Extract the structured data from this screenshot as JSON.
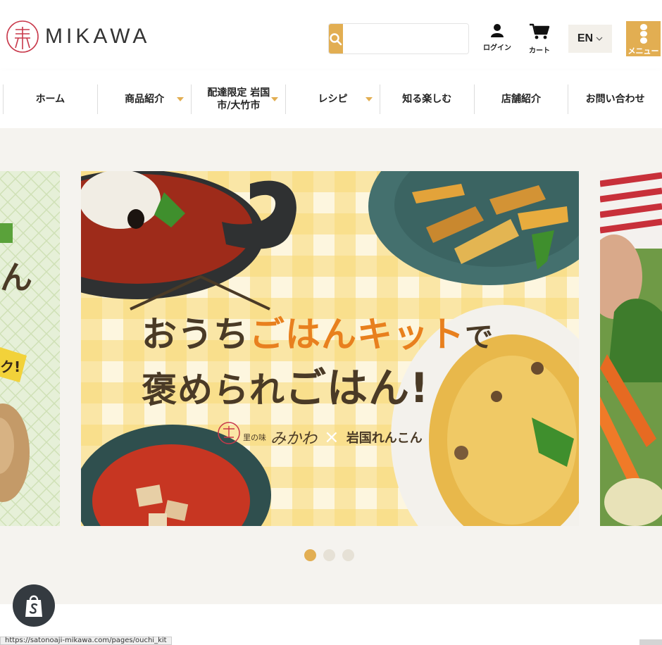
{
  "header": {
    "brand": "MIKAWA",
    "search_placeholder": "",
    "login_label": "ログイン",
    "cart_label": "カート",
    "language_code": "EN",
    "menu_label": "メニュー"
  },
  "nav": {
    "items": [
      {
        "label": "ホーム"
      },
      {
        "label": "商品紹介"
      },
      {
        "label_line1": "配達限定 岩国",
        "label_line2": "市/大竹市"
      },
      {
        "label": "レシピ"
      },
      {
        "label": "知る楽しむ"
      },
      {
        "label": "店舗紹介"
      },
      {
        "label": "お問い合わせ"
      }
    ]
  },
  "hero": {
    "main_slide": {
      "headline_line1_part1": "おうち",
      "headline_line1_part2": "ごはんキット",
      "headline_line1_part3": "で",
      "headline_line2_part1": "褒められ",
      "headline_line2_part2": "ごはん!",
      "brand_small": "里の味",
      "brand_script": "みかわ",
      "cross": "×",
      "partner": "岩国れんこん"
    },
    "left_slide": {
      "text_fragment": "ん",
      "badge_fragment": "ク!"
    },
    "dots": [
      {
        "active": true
      },
      {
        "active": false
      },
      {
        "active": false
      }
    ]
  },
  "status_bar": {
    "url": "https://satonoaji-mikawa.com/pages/ouchi_kit"
  },
  "colors": {
    "accent": "#e2ae52",
    "headline_brown": "#4a3a26",
    "headline_orange": "#e8801e",
    "background": "#f5f3ef"
  }
}
